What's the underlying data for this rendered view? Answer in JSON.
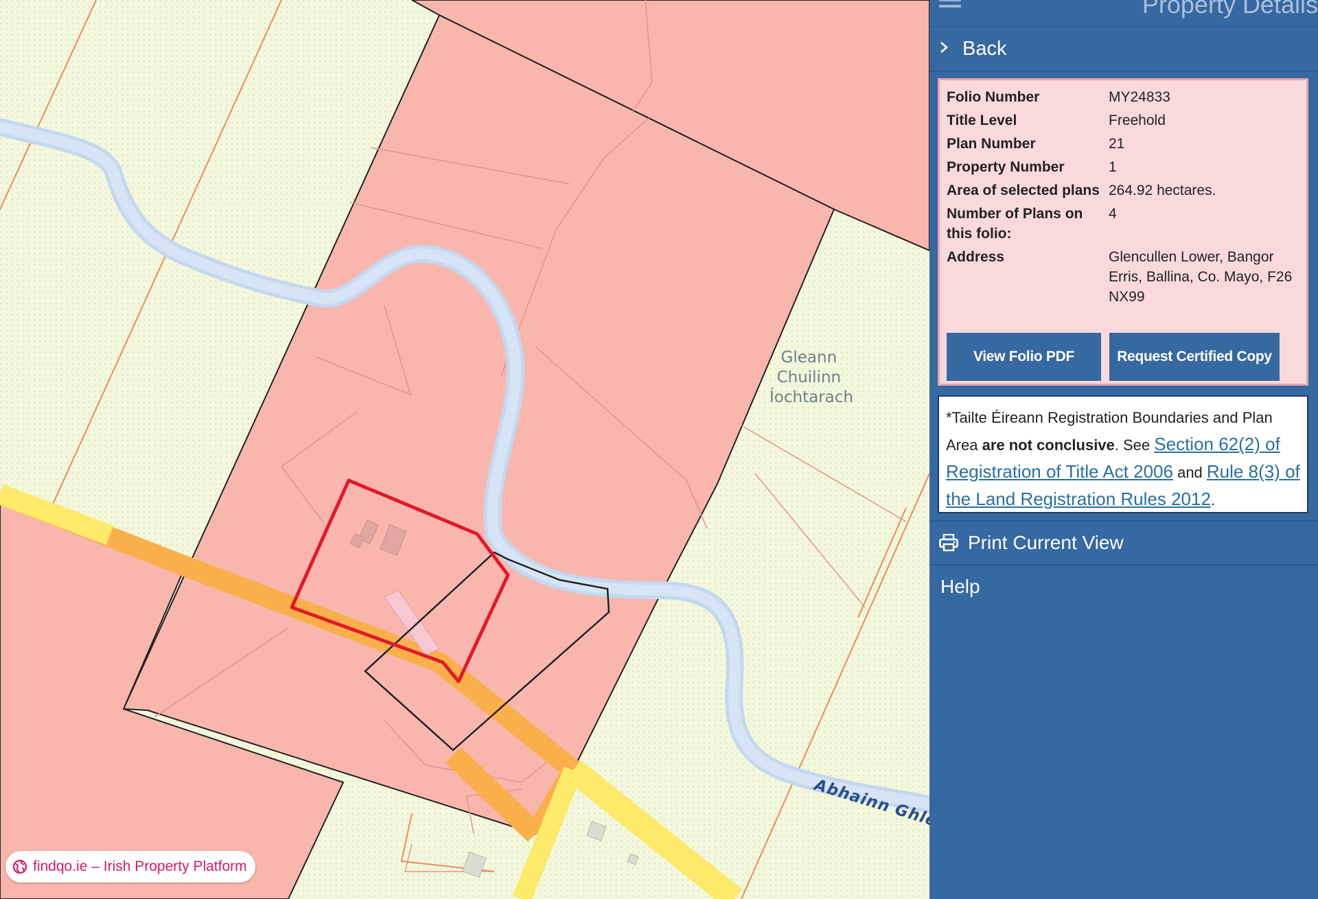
{
  "map": {
    "place_label_lines": [
      "Gleann",
      "Chuilinn",
      "Íochtarach"
    ],
    "river_label": "Abhainn Ghle",
    "colors": {
      "background": "#f3f8dc",
      "registered_parcel": "#f8b6ad",
      "river": "#cfe0f4",
      "road": "#fde96a",
      "road_major": "#f9b04a",
      "selected_boundary": "#e2182a",
      "parcel_outline": "#222222"
    }
  },
  "panel": {
    "title": "Property Details",
    "back_label": "Back",
    "details": [
      {
        "key": "Folio Number",
        "value": "MY24833"
      },
      {
        "key": "Title Level",
        "value": "Freehold"
      },
      {
        "key": "Plan Number",
        "value": "21"
      },
      {
        "key": "Property Number",
        "value": "1"
      },
      {
        "key": "Area of selected plans",
        "value": "264.92 hectares."
      },
      {
        "key": "Number of Plans on this folio:",
        "value": "4"
      },
      {
        "key": "Address",
        "value": "Glencullen Lower, Bangor Erris, Ballina, Co. Mayo, F26 NX99"
      }
    ],
    "buttons": {
      "view_pdf": "View Folio PDF",
      "certified_copy": "Request Certified Copy"
    },
    "disclaimer": {
      "prefix": "*Tailte Éireann Registration Boundaries and Plan Area ",
      "bold": "are not conclusive",
      "middle": ". See ",
      "link1": "Section 62(2) of Registration of Title Act 2006",
      "joiner": " and ",
      "link2": "Rule 8(3) of the Land Registration Rules 2012",
      "suffix": "."
    },
    "print_label": "Print Current View",
    "help_label": "Help"
  },
  "badge": {
    "text": "findqo.ie – Irish Property Platform",
    "color": "#d8186c"
  }
}
